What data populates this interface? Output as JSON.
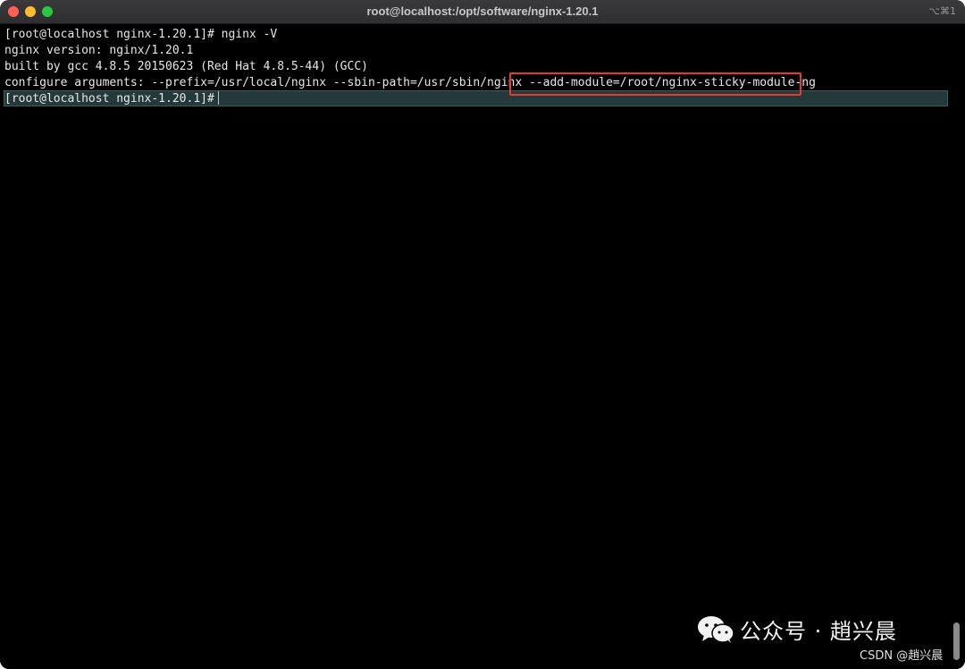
{
  "window": {
    "title": "root@localhost:/opt/software/nginx-1.20.1",
    "shortcut": "⌥⌘1"
  },
  "terminal": {
    "lines": [
      "[root@localhost nginx-1.20.1]# nginx -V",
      "nginx version: nginx/1.20.1",
      "built by gcc 4.8.5 20150623 (Red Hat 4.8.5-44) (GCC)",
      "configure arguments: --prefix=/usr/local/nginx --sbin-path=/usr/sbin/nginx --add-module=/root/nginx-sticky-module-ng",
      "[root@localhost nginx-1.20.1]#"
    ]
  },
  "watermark": {
    "text": "公众号 · 趙兴晨",
    "sub": "CSDN @趙兴晨",
    "icon": "wechat-icon"
  },
  "colors": {
    "highlight": "#e53935",
    "close": "#ff5f57",
    "minimize": "#febc2e",
    "zoom": "#28c840"
  }
}
